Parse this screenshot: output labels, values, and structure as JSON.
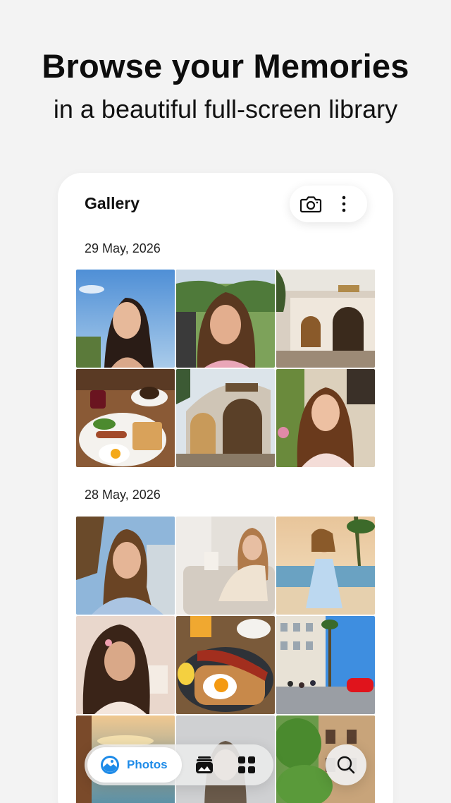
{
  "promo": {
    "title": "Browse your Memories",
    "subtitle": "in a beautiful full-screen library"
  },
  "header": {
    "title": "Gallery",
    "camera_icon": "camera-icon",
    "more_icon": "more-vertical-icon"
  },
  "sections": [
    {
      "date": "29 May, 2026",
      "photos": [
        "portrait-woman-sky",
        "woman-in-car",
        "cafe-exterior-night",
        "breakfast-coffee",
        "sunset-cafe-storefront",
        "woman-in-garden"
      ]
    },
    {
      "date": "28 May, 2026",
      "photos": [
        "woman-white-shirt",
        "woman-reading-sofa",
        "woman-beach-dress",
        "girl-pink-room",
        "bacon-egg-toast",
        "city-street-red-car",
        "sunset-sea-terrace",
        "woman-portrait-soft",
        "garden-trees-building"
      ]
    }
  ],
  "tabbar": {
    "photos_label": "Photos",
    "photos_icon": "photos-icon",
    "albums_icon": "albums-icon",
    "collections_icon": "grid-icon",
    "search_icon": "search-icon"
  },
  "colors": {
    "accent": "#1e8be8",
    "background": "#f3f3f3",
    "card": "#ffffff"
  }
}
